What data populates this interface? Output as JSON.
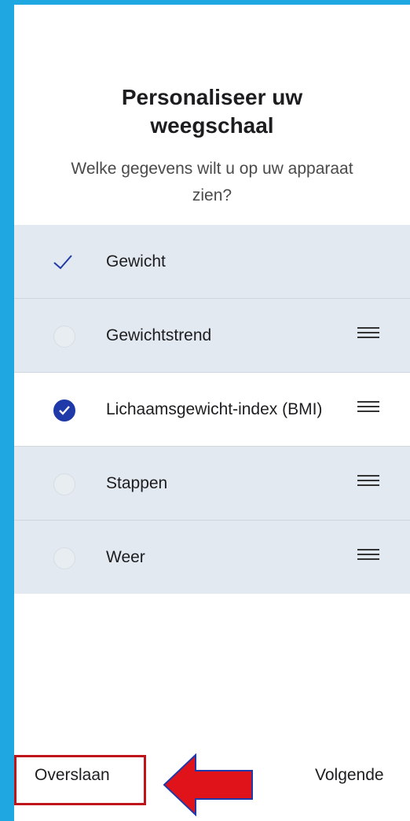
{
  "header": {
    "title": "Personaliseer uw weegschaal",
    "subtitle": "Welke gegevens wilt u op uw apparaat zien?"
  },
  "items": [
    {
      "label": "Gewicht",
      "state": "fixed-checked",
      "draggable": false
    },
    {
      "label": "Gewichtstrend",
      "state": "unchecked",
      "draggable": true
    },
    {
      "label": "Lichaamsgewicht-index (BMI)",
      "state": "checked",
      "draggable": true
    },
    {
      "label": "Stappen",
      "state": "unchecked",
      "draggable": true
    },
    {
      "label": "Weer",
      "state": "unchecked",
      "draggable": true
    }
  ],
  "footer": {
    "skip_label": "Overslaan",
    "next_label": "Volgende"
  },
  "colors": {
    "frame": "#1ea7e0",
    "accent": "#1f3aa8",
    "highlight": "#c0141b",
    "arrow": "#e0131a"
  }
}
